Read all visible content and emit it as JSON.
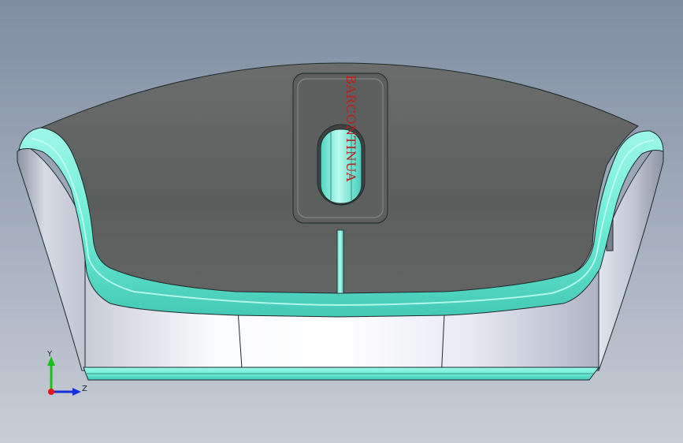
{
  "model_view": {
    "description_free": true,
    "logo_text": "BARCONTINUA",
    "colors": {
      "top_shell": "#5a5d5c",
      "top_shell_highlight": "#777a78",
      "trim": "#7df2dc",
      "trim_dark": "#3ec5b4",
      "side_shell_light": "#f4f6fb",
      "side_shell_mid": "#d8dce6",
      "side_shell_shadow": "#9aa0ae",
      "edge_line": "#1d2a2a",
      "logo_red": "#b4241e"
    }
  },
  "triad": {
    "y_label": "Y",
    "z_label": "Z",
    "colors": {
      "y_axis": "#19c219",
      "z_axis": "#1530d8",
      "origin": "#e01818"
    }
  }
}
